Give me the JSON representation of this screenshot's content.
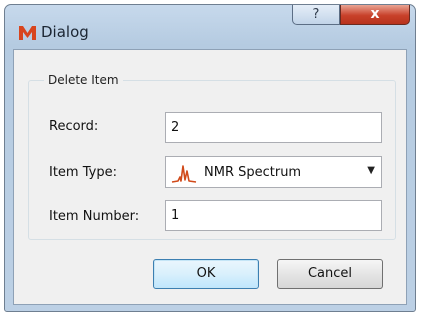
{
  "window": {
    "title": "Dialog",
    "help_glyph": "?",
    "close_glyph": "x"
  },
  "group": {
    "title": "Delete Item"
  },
  "form": {
    "record_label": "Record:",
    "record_value": "2",
    "item_type_label": "Item Type:",
    "item_type_value": "NMR Spectrum",
    "item_type_icon": "nmr-spectrum-icon",
    "item_number_label": "Item Number:",
    "item_number_value": "1"
  },
  "buttons": {
    "ok": "OK",
    "cancel": "Cancel"
  },
  "colors": {
    "app_icon": "#d8451e",
    "spectrum_icon": "#d14a1a"
  }
}
